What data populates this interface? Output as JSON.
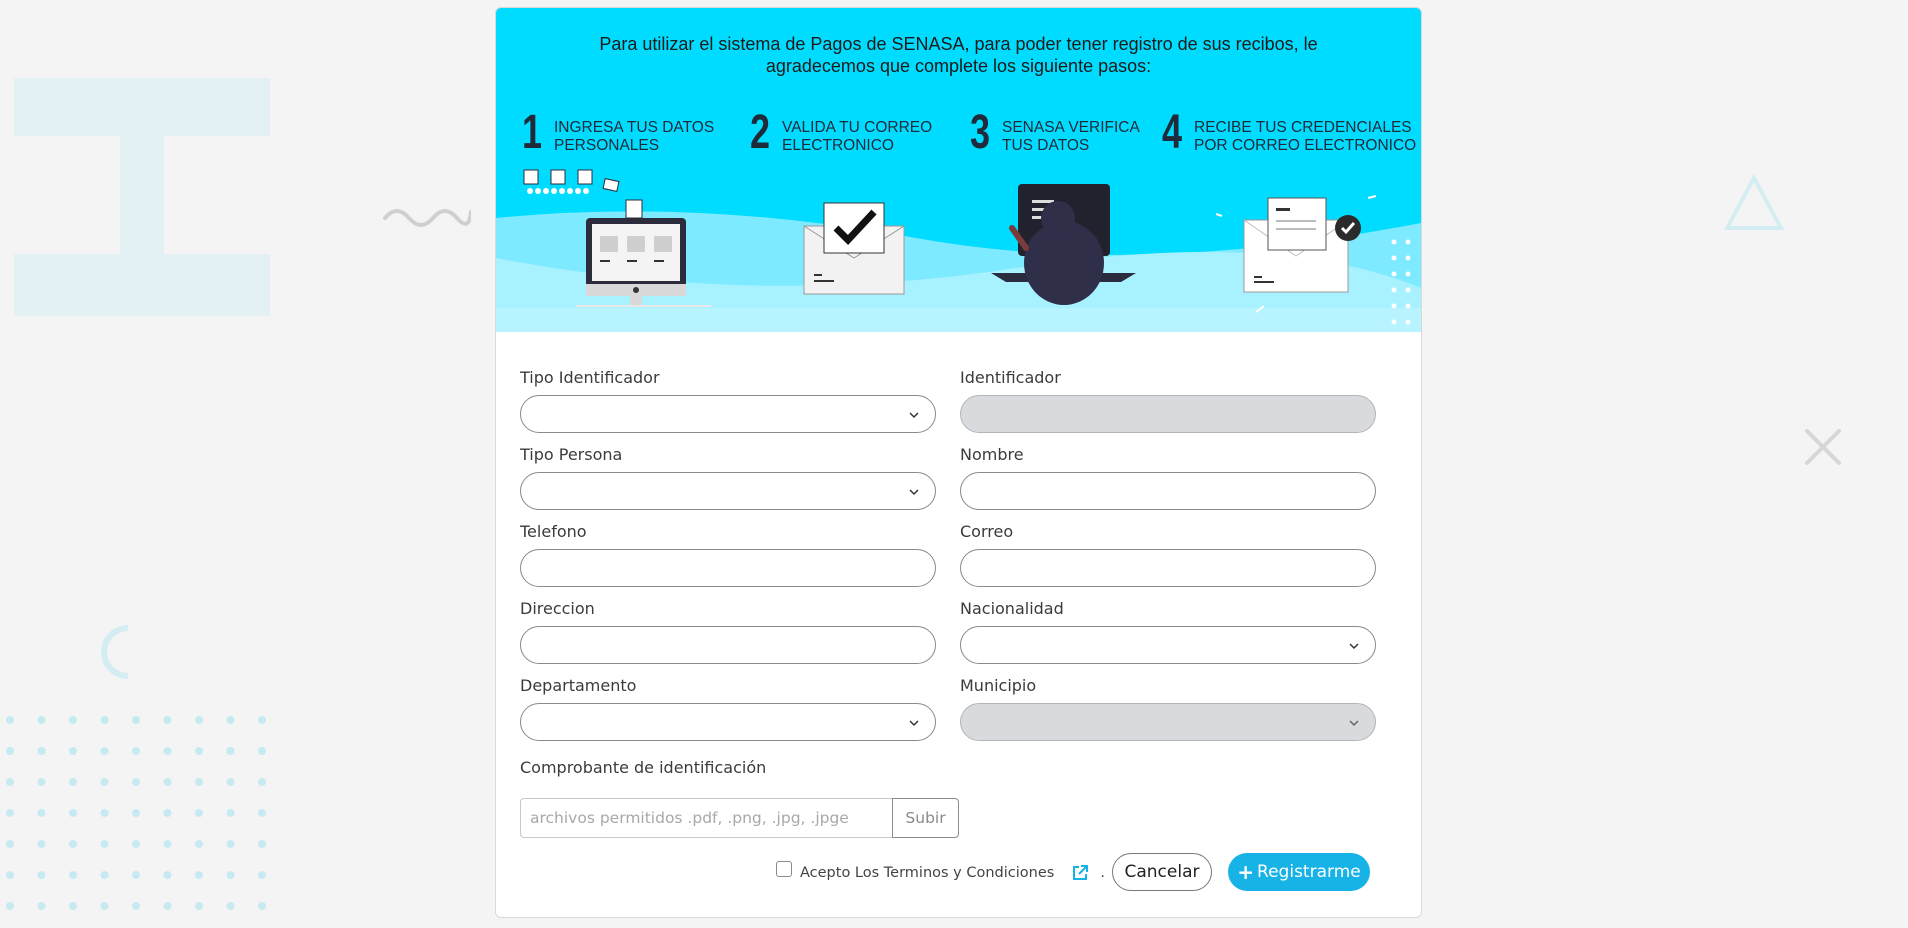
{
  "banner": {
    "intro": "Para utilizar el sistema de Pagos de SENASA, para poder tener registro de sus recibos, le agradecemos que complete los siguiente pasos:",
    "steps": [
      {
        "number": "1",
        "text": "INGRESA TUS DATOS\nPERSONALES"
      },
      {
        "number": "2",
        "text": "VALIDA TU  CORREO\nELECTRONICO"
      },
      {
        "number": "3",
        "text": "SENASA VERIFICA\nTUS DATOS"
      },
      {
        "number": "4",
        "text": "RECIBE TUS CREDENCIALES\nPOR CORREO ELECTRONICO"
      }
    ]
  },
  "form": {
    "fields": {
      "tipo_identificador": {
        "label": "Tipo Identificador",
        "value": ""
      },
      "identificador": {
        "label": "Identificador",
        "value": ""
      },
      "tipo_persona": {
        "label": "Tipo Persona",
        "value": ""
      },
      "nombre": {
        "label": "Nombre",
        "value": ""
      },
      "telefono": {
        "label": "Telefono",
        "value": ""
      },
      "correo": {
        "label": "Correo",
        "value": ""
      },
      "direccion": {
        "label": "Direccion",
        "value": ""
      },
      "nacionalidad": {
        "label": "Nacionalidad",
        "value": ""
      },
      "departamento": {
        "label": "Departamento",
        "value": ""
      },
      "municipio": {
        "label": "Municipio",
        "value": ""
      }
    },
    "comprobante": {
      "label": "Comprobante de identificación",
      "placeholder": "archivos permitidos .pdf, .png, .jpg, .jpge",
      "button": "Subir"
    },
    "terms": {
      "label": "Acepto Los Terminos y Condiciones",
      "trailing": "."
    },
    "buttons": {
      "cancel": "Cancelar",
      "register": "Registrarme",
      "register_icon": "+"
    }
  },
  "colors": {
    "banner_bg": "#00dcff",
    "primary": "#18b3e6",
    "page_bg": "#f4f4f4",
    "disabled_field": "#d8dadd"
  },
  "icons": [
    "chevron-down-icon",
    "external-link-icon",
    "plus-icon",
    "computer-icon",
    "envelope-check-icon",
    "person-at-monitor-icon",
    "envelope-credentials-icon"
  ]
}
